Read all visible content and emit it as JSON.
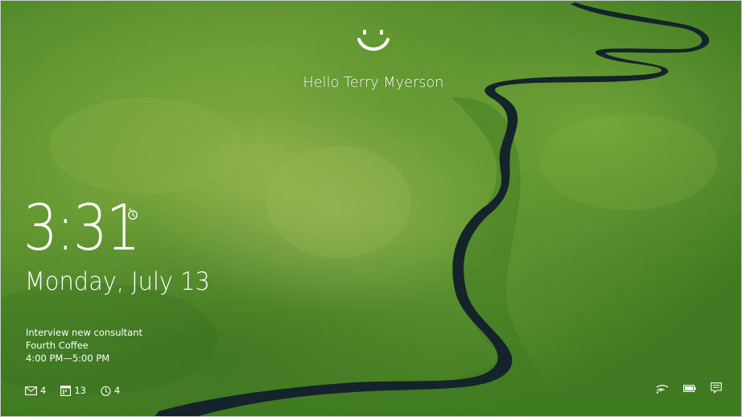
{
  "greeting": "Hello Terry Myerson",
  "clock": {
    "time": "3:31",
    "date": "Monday, July 13"
  },
  "event": {
    "title": "Interview new consultant",
    "location": "Fourth Coffee",
    "time_range": "4:00 PM—5:00 PM"
  },
  "badges": {
    "mail_count": "4",
    "calendar_count": "13",
    "alarm_count": "4"
  },
  "icons": {
    "face": "smiley-icon",
    "alarm": "alarm-clock-icon",
    "mail": "mail-icon",
    "calendar": "calendar-icon",
    "wifi": "wifi-icon",
    "battery": "battery-icon",
    "notifications": "action-center-icon"
  },
  "colors": {
    "text": "#ffffff",
    "wallpaper_green": "#5d8f2c",
    "river": "#14242a"
  }
}
